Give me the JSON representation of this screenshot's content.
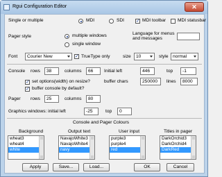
{
  "window": {
    "title": "Rgui Configuration Editor",
    "close_glyph": "✕"
  },
  "sdi_mdi": {
    "label": "Single or multiple",
    "mdi": "MDI",
    "sdi": "SDI",
    "mdi_toolbar": "MDI toolbar",
    "mdi_statusbar": "MDI statusbar"
  },
  "pager_style": {
    "label": "Pager style",
    "multiple": "multiple windows",
    "single": "single window"
  },
  "language": {
    "label_line1": "Language for menus",
    "label_line2": "and messages",
    "value": ""
  },
  "font": {
    "label": "Font",
    "value": "Courier New",
    "truetype": "TrueType only",
    "size_label": "size",
    "size_value": "10",
    "style_label": "style",
    "style_value": "normal"
  },
  "console": {
    "label": "Console",
    "rows_label": "rows",
    "rows_value": "38",
    "columns_label": "columns",
    "columns_value": "66",
    "initial_left_label": "Initial left",
    "initial_left_value": "446",
    "top_label": "top",
    "top_value": "-1",
    "set_options": "set options(width) on resize?",
    "buffer_chars_label": "buffer chars",
    "buffer_chars_value": "250000",
    "lines_label": "lines",
    "lines_value": "8000",
    "buffer_default": "buffer console by default?"
  },
  "pager": {
    "label": "Pager",
    "rows_label": "rows",
    "rows_value": "25",
    "columns_label": "columns",
    "columns_value": "80"
  },
  "graphics": {
    "label": "Graphics windows: initial left",
    "left_value": "-25",
    "top_label": "top",
    "top_value": "0"
  },
  "colours": {
    "section_title": "Console and Pager Colours",
    "lists": [
      {
        "header": "Background",
        "items": [
          "wheat3",
          "wheat4",
          "white"
        ],
        "selected": 2
      },
      {
        "header": "Output text",
        "items": [
          "NavajoWhite3",
          "NavajoWhite4",
          "navy"
        ],
        "selected": 2
      },
      {
        "header": "User input",
        "items": [
          "purple3",
          "purple4",
          "red"
        ],
        "selected": 2
      },
      {
        "header": "Titles in pager",
        "items": [
          "DarkOrchid3",
          "DarkOrchid4",
          "DarkRed"
        ],
        "selected": 2
      }
    ]
  },
  "buttons": {
    "apply": "Apply",
    "save": "Save...",
    "load": "Load...",
    "ok": "OK",
    "cancel": "Cancel"
  },
  "colors": {
    "accent": "#3399ff",
    "titlebar": "#bcd3ea",
    "close": "#c44a33"
  }
}
